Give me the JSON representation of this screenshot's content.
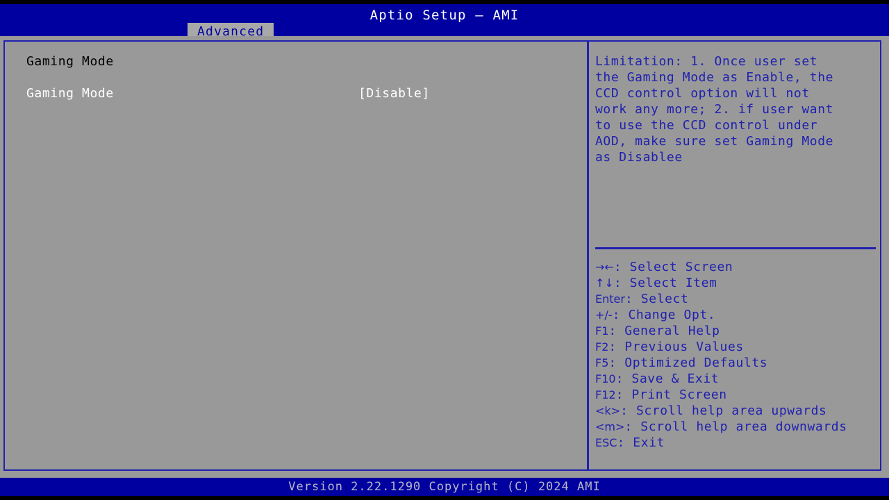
{
  "window": {
    "title": "Aptio Setup – AMI",
    "colors": {
      "header_blue": "#0000a0",
      "panel_gray": "#999999",
      "border_blue": "#2020b0",
      "tab_gray": "#a8a8a8",
      "selected_text": "#ffffff",
      "section_text": "#000000"
    }
  },
  "tabs": [
    {
      "label": "Advanced",
      "active": true
    }
  ],
  "settings": {
    "section_title": "Gaming Mode",
    "options": [
      {
        "label": "Gaming Mode",
        "value": "[Disable]",
        "selected": true
      }
    ]
  },
  "help": {
    "lines": [
      "Limitation: 1. Once user set",
      "the Gaming Mode as Enable, the",
      "CCD control option will not",
      "work any more; 2. if user want",
      "to use the CCD control under",
      "AOD, make sure set Gaming Mode",
      "as Disablee"
    ]
  },
  "legend": {
    "items": [
      {
        "keys": "→←",
        "text": ": Select Screen"
      },
      {
        "keys": "↑↓",
        "text": ": Select Item"
      },
      {
        "keys": "Enter",
        "text": ": Select"
      },
      {
        "keys": "+/-",
        "text": ": Change Opt."
      },
      {
        "keys": "F1",
        "text": ": General Help"
      },
      {
        "keys": "F2",
        "text": ": Previous Values"
      },
      {
        "keys": "F5",
        "text": ": Optimized Defaults"
      },
      {
        "keys": "F10",
        "text": ": Save & Exit"
      },
      {
        "keys": "F12",
        "text": ": Print Screen"
      },
      {
        "keys": "<k>",
        "text": ": Scroll help area upwards"
      },
      {
        "keys": "<m>",
        "text": ": Scroll help area downwards"
      },
      {
        "keys": "ESC",
        "text": ": Exit"
      }
    ]
  },
  "footer": {
    "text": "Version 2.22.1290 Copyright (C) 2024 AMI"
  }
}
